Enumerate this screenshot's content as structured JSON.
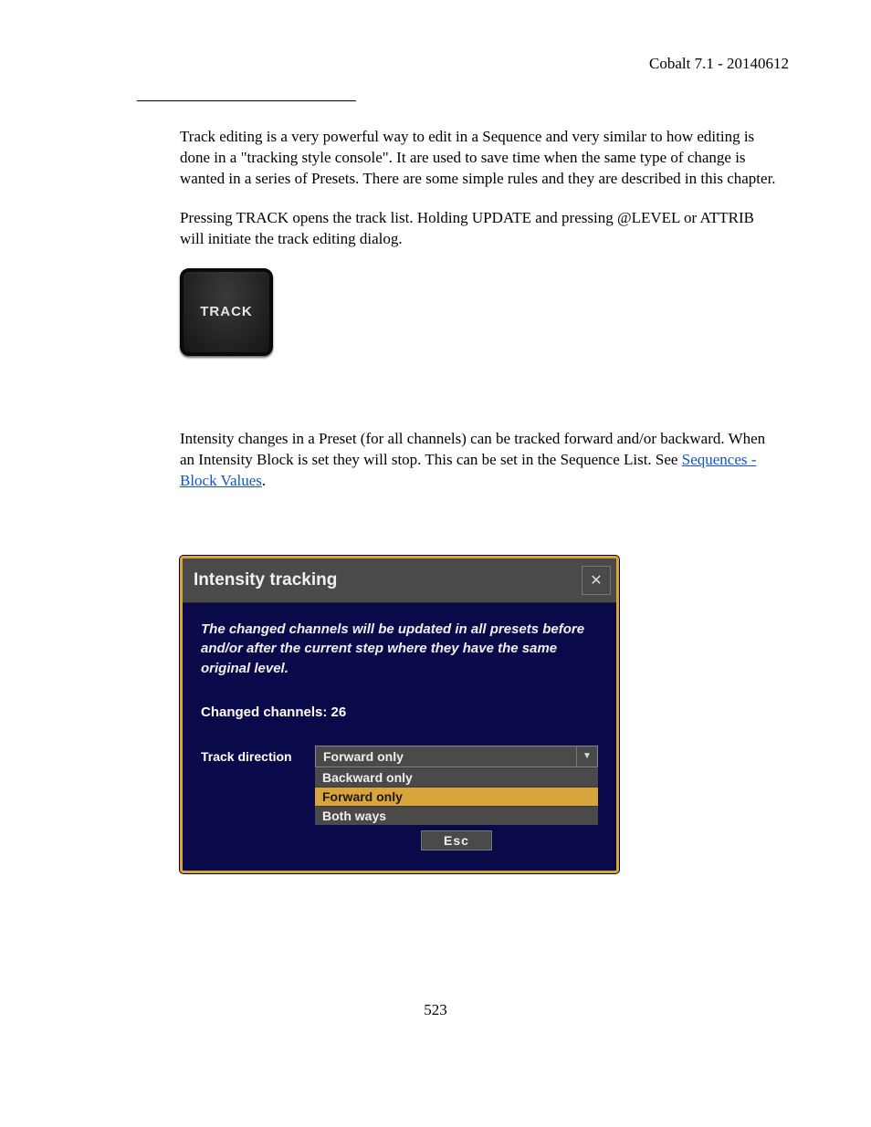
{
  "header": {
    "right": "Cobalt 7.1 - 20140612"
  },
  "content": {
    "para1": "Track editing is a very powerful way to edit in a Sequence and very similar to how editing is done in a \"tracking style console\". It are used to save time when the same type of change is wanted in a series of Presets. There are some simple rules and they are described in this chapter.",
    "para2": "Pressing TRACK opens the track list. Holding UPDATE and pressing @LEVEL or ATTRIB will initiate the  track editing dialog.",
    "para3_a": "Intensity changes in a Preset (for all channels) can be tracked forward and/or backward. When an Intensity Block is set they will stop. This can be set in the Sequence List. See ",
    "para3_link": "Sequences - Block Values",
    "para3_b": "."
  },
  "track_button": {
    "label": "TRACK"
  },
  "dialog": {
    "title": "Intensity tracking",
    "description": "The changed channels will be updated in all presets before and/or after the current step where they have the same original level.",
    "changed_label": "Changed channels:",
    "changed_count": "26",
    "direction_label": "Track direction",
    "selected": "Forward only",
    "options": {
      "0": "Backward only",
      "1": "Forward only",
      "2": "Both ways"
    },
    "esc_label": "Esc"
  },
  "page_number": "523"
}
